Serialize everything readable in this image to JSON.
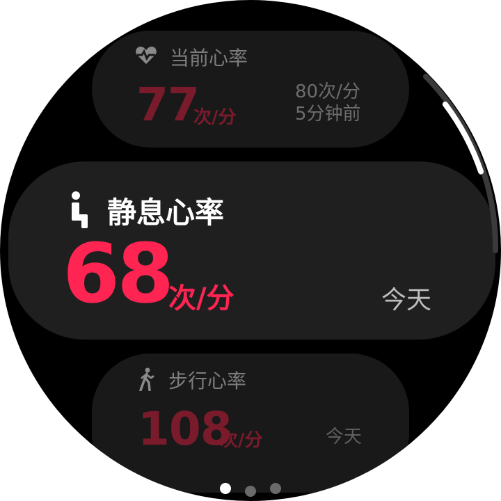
{
  "cards": {
    "current": {
      "title": "当前心率",
      "icon": "heart-pulse-icon",
      "value": "77",
      "unit": "次/分",
      "aside_value": "80次/分",
      "aside_time": "5分钟前"
    },
    "resting": {
      "title": "静息心率",
      "icon": "sitting-person-icon",
      "value": "68",
      "unit": "次/分",
      "aside_time": "今天"
    },
    "walking": {
      "title": "步行心率",
      "icon": "walking-person-icon",
      "value": "108",
      "unit": "次/分",
      "aside_time": "今天"
    }
  },
  "pager": {
    "count": 3,
    "active_index": 0
  },
  "scroll": {
    "position_fraction": 0.3
  },
  "colors": {
    "accent": "#ff2452",
    "accent_dim": "#7a1b2c",
    "card": "#1f1f1f",
    "background": "#000000"
  }
}
